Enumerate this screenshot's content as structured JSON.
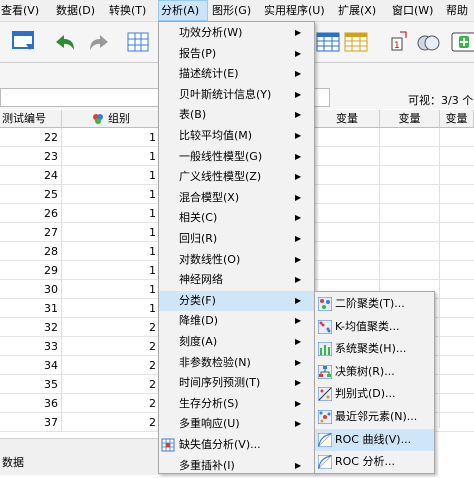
{
  "menubar": {
    "items": [
      "查看(V)",
      "数据(D)",
      "转换(T)",
      "分析(A)",
      "图形(G)",
      "实用程序(U)",
      "扩展(X)",
      "窗口(W)",
      "帮助"
    ]
  },
  "infobar": {
    "visible": "可视：3/3 个"
  },
  "grid": {
    "headers": {
      "col1": "测试编号",
      "col2": "组别",
      "var": "变量"
    },
    "rows": [
      {
        "id": "22",
        "grp": "1"
      },
      {
        "id": "23",
        "grp": "1"
      },
      {
        "id": "24",
        "grp": "1"
      },
      {
        "id": "25",
        "grp": "1"
      },
      {
        "id": "26",
        "grp": "1"
      },
      {
        "id": "27",
        "grp": "1"
      },
      {
        "id": "28",
        "grp": "1"
      },
      {
        "id": "29",
        "grp": "1"
      },
      {
        "id": "30",
        "grp": "1"
      },
      {
        "id": "31",
        "grp": "1"
      },
      {
        "id": "32",
        "grp": "2"
      },
      {
        "id": "33",
        "grp": "2"
      },
      {
        "id": "34",
        "grp": "2"
      },
      {
        "id": "35",
        "grp": "2"
      },
      {
        "id": "36",
        "grp": "2"
      },
      {
        "id": "37",
        "grp": "2"
      }
    ]
  },
  "bottom": {
    "tab": "数据"
  },
  "analyze_menu": {
    "items": [
      {
        "label": "功效分析(W)",
        "submenu": true
      },
      {
        "label": "报告(P)",
        "submenu": true
      },
      {
        "label": "描述统计(E)",
        "submenu": true
      },
      {
        "label": "贝叶斯统计信息(Y)",
        "submenu": true
      },
      {
        "label": "表(B)",
        "submenu": true
      },
      {
        "label": "比较平均值(M)",
        "submenu": true
      },
      {
        "label": "一般线性模型(G)",
        "submenu": true
      },
      {
        "label": "广义线性模型(Z)",
        "submenu": true
      },
      {
        "label": "混合模型(X)",
        "submenu": true
      },
      {
        "label": "相关(C)",
        "submenu": true
      },
      {
        "label": "回归(R)",
        "submenu": true
      },
      {
        "label": "对数线性(O)",
        "submenu": true
      },
      {
        "label": "神经网络",
        "submenu": true
      },
      {
        "label": "分类(F)",
        "submenu": true,
        "highlighted": true
      },
      {
        "label": "降维(D)",
        "submenu": true
      },
      {
        "label": "刻度(A)",
        "submenu": true
      },
      {
        "label": "非参数检验(N)",
        "submenu": true
      },
      {
        "label": "时间序列预测(T)",
        "submenu": true
      },
      {
        "label": "生存分析(S)",
        "submenu": true
      },
      {
        "label": "多重响应(U)",
        "submenu": true
      },
      {
        "label": "缺失值分析(V)...",
        "submenu": false,
        "icon": "missing-values-icon"
      },
      {
        "label": "多重插补(I)",
        "submenu": true
      }
    ]
  },
  "cluster_menu": {
    "items": [
      {
        "label": "二阶聚类(T)...",
        "icon": "twostep-cluster-icon"
      },
      {
        "label": "K-均值聚类...",
        "icon": "kmeans-cluster-icon"
      },
      {
        "label": "系统聚类(H)...",
        "icon": "hierarchical-cluster-icon"
      },
      {
        "label": "决策树(R)...",
        "icon": "tree-icon"
      },
      {
        "label": "判别式(D)...",
        "icon": "discriminant-icon"
      },
      {
        "label": "最近邻元素(N)...",
        "icon": "nearest-neighbor-icon"
      },
      {
        "label": "ROC 曲线(V)...",
        "icon": "roc-curve-icon",
        "highlighted": true
      },
      {
        "label": "ROC 分析...",
        "icon": "roc-analysis-icon"
      }
    ]
  },
  "colors": {
    "highlight": "#cfe6f8",
    "menu_bg": "#f2f2f2"
  }
}
